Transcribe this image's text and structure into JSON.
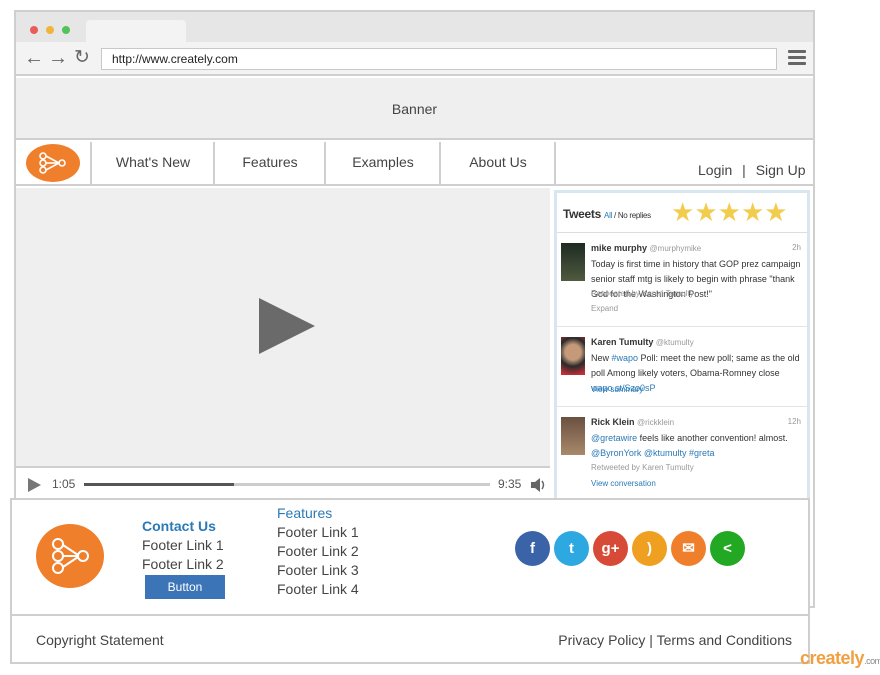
{
  "browser": {
    "url": "http://www.creately.com",
    "dot_colors": [
      "#e85c5c",
      "#f0b43c",
      "#52c25a"
    ]
  },
  "banner": {
    "text": "Banner"
  },
  "nav": {
    "items": [
      "What's New",
      "Features",
      "Examples",
      "About Us"
    ],
    "login": "Login",
    "separator": "|",
    "signup": "Sign Up"
  },
  "video": {
    "current_time": "1:05",
    "total_time": "9:35",
    "progress_fraction": 0.37
  },
  "tweets": {
    "title": "Tweets",
    "filter_all": "All",
    "filter_sep": " / ",
    "filter_noreplies": "No replies",
    "rating": 5,
    "items": [
      {
        "name": "mike murphy",
        "handle": "@murphymike",
        "time": "2h",
        "text": "Today is first time in history that GOP prez campaign senior staff mtg is likely to begin with phrase \"thank God for the Washington Post!\"",
        "meta1": "Retweeted by Karen Tumulty",
        "meta2": "Expand"
      },
      {
        "name": "Karen Tumulty",
        "handle": "@ktumulty",
        "time": "",
        "text_a": "New ",
        "text_link": "#wapo",
        "text_b": " Poll: meet the new poll; same as the old poll Among likely voters, Obama-Romney close ",
        "text_link2": "wapo.st/Szo0sP",
        "meta1": "View summary"
      },
      {
        "name": "Rick Klein",
        "handle": "@rickklein",
        "time": "12h",
        "text_link": "@gretawire",
        "text_a": " feels like another convention! almost. ",
        "text_link2": "@ByronYork @ktumulty #greta",
        "meta1": "Retweeted by Karen Tumulty",
        "meta2": "View conversation"
      }
    ]
  },
  "footer": {
    "contact_heading": "Contact Us",
    "contact_links": [
      "Footer Link 1",
      "Footer Link 2"
    ],
    "button_label": "Button",
    "features_heading": "Features",
    "feature_links": [
      "Footer Link 1",
      "Footer Link 2",
      "Footer Link 3",
      "Footer Link 4"
    ],
    "social": [
      {
        "name": "facebook-icon",
        "glyph": "f",
        "color": "#3a63a8"
      },
      {
        "name": "twitter-icon",
        "glyph": "t",
        "color": "#2ea8e0"
      },
      {
        "name": "google-plus-icon",
        "glyph": "g+",
        "color": "#d84a38"
      },
      {
        "name": "rss-icon",
        "glyph": ")",
        "color": "#f0a020"
      },
      {
        "name": "email-icon",
        "glyph": "✉",
        "color": "#f07f2c"
      },
      {
        "name": "share-icon",
        "glyph": "<",
        "color": "#22a822"
      }
    ],
    "copyright": "Copyright Statement",
    "privacy": "Privacy Policy",
    "pipe": " | ",
    "terms": "Terms and Conditions"
  },
  "watermark": {
    "brand": "creately",
    "suffix": ".com"
  }
}
